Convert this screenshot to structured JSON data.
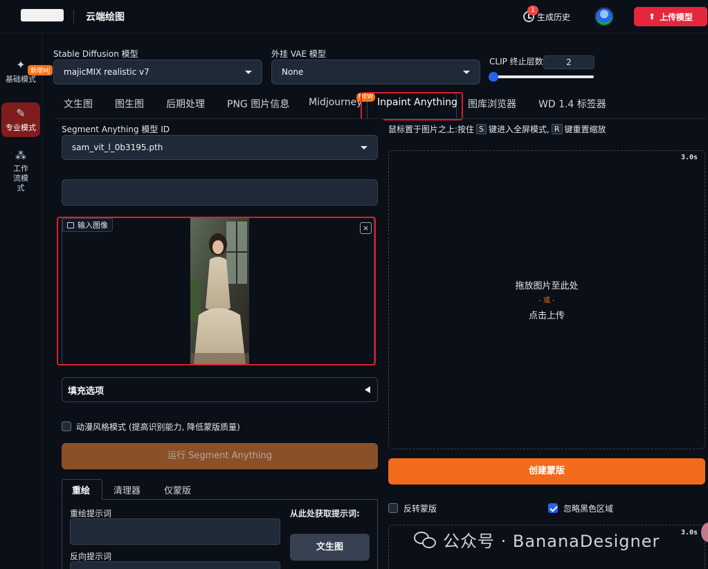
{
  "app": {
    "title": "云端绘图",
    "history_label": "生成历史",
    "history_count": "1",
    "upload_label": "上传模型",
    "colors": {
      "accent_red": "#e5273e",
      "accent_orange": "#f26a1b",
      "highlight_box": "#e11d26"
    }
  },
  "sidebar": {
    "items": [
      {
        "label": "基础模式",
        "icon": "sparkle-icon"
      },
      {
        "label": "专业模式",
        "icon": "brush-icon",
        "active": true,
        "badge": "新增MJ"
      },
      {
        "label": "工作流模式",
        "icon": "workflow-icon"
      }
    ]
  },
  "settings": {
    "sd_model": {
      "label": "Stable Diffusion 模型",
      "value": "majicMIX realistic v7"
    },
    "vae": {
      "label": "外挂 VAE 模型",
      "value": "None"
    },
    "clip": {
      "label": "CLIP 终止层数",
      "value": "2",
      "slider_fraction": 0.0
    }
  },
  "tabs": [
    {
      "label": "文生图"
    },
    {
      "label": "图生图"
    },
    {
      "label": "后期处理"
    },
    {
      "label": "PNG 图片信息"
    },
    {
      "label": "Midjourney"
    },
    {
      "label": "Inpaint Anything",
      "active": true,
      "badge": "NEW"
    },
    {
      "label": "图库浏览器"
    },
    {
      "label": "WD 1.4 标签器"
    }
  ],
  "left": {
    "sam_label": "Segment Anything 模型 ID",
    "sam_value": "sam_vit_l_0b3195.pth",
    "image_label": "输入图像",
    "close_glyph": "×",
    "fill_options": "填充选项",
    "anime_mode": "动漫风格模式 (提高识别能力, 降低蒙版质量)",
    "run_button": "运行 Segment Anything",
    "subtabs": [
      "重绘",
      "清理器",
      "仅蒙版"
    ],
    "prompt_label": "重绘提示词",
    "negative_label": "反向提示词",
    "get_prompt_label": "从此处获取提示词:",
    "txt2img_button": "文生图"
  },
  "right": {
    "hint_prefix": "鼠标置于图片之上:按住",
    "hint_key1": "S",
    "hint_mid": "键进入全屏模式,",
    "hint_key2": "R",
    "hint_suffix": "键重置缩放",
    "timer": "3.0s",
    "drop_line1": "拖放图片至此处",
    "drop_or": "- 或 -",
    "drop_line2": "点击上传",
    "create_mask": "创建蒙版",
    "invert_mask": "反转蒙版",
    "ignore_black": "忽略黑色区域",
    "timer2": "3.0s"
  },
  "watermark": "公众号 · BananaDesigner"
}
